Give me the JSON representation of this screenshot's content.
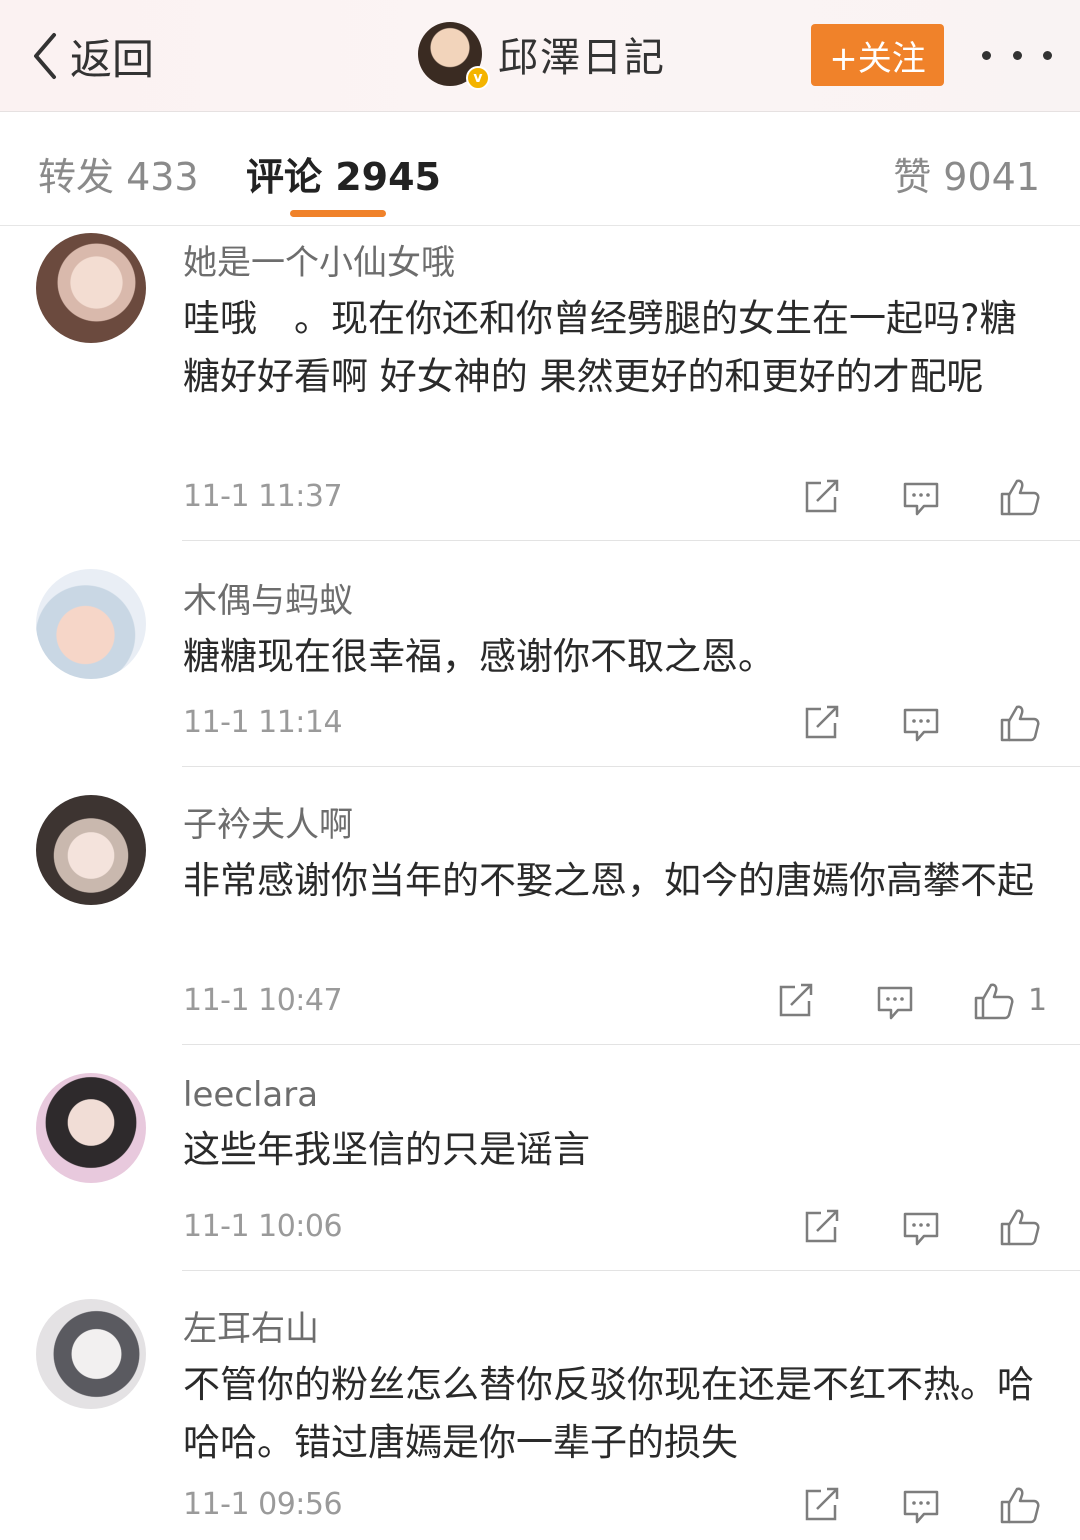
{
  "nav": {
    "back_label": "返回",
    "title": "邱澤日記",
    "follow_label": "+关注",
    "more_icon": "more-dots-icon"
  },
  "tabs": {
    "repost_label": "转发 433",
    "comment_label": "评论 2945",
    "like_label": "赞 9041",
    "active": "comment"
  },
  "colors": {
    "accent": "#f0822a",
    "verify": "#f4b400"
  },
  "comments": [
    {
      "user": "她是一个小仙女哦",
      "text": "哇哦　。现在你还和你曾经劈腿的女生在一起吗?糖糖好好看啊  好女神的   果然更好的和更好的才配呢",
      "time": "11-1 11:37",
      "likes": ""
    },
    {
      "user": "木偶与蚂蚁",
      "text": "糖糖现在很幸福，感谢你不取之恩。",
      "time": "11-1 11:14",
      "likes": ""
    },
    {
      "user": "子衿夫人啊",
      "text": "非常感谢你当年的不娶之恩，如今的唐嫣你高攀不起",
      "time": "11-1 10:47",
      "likes": "1"
    },
    {
      "user": "leeclara",
      "text": "这些年我坚信的只是谣言",
      "time": "11-1 10:06",
      "likes": ""
    },
    {
      "user": "左耳右山",
      "text": "不管你的粉丝怎么替你反驳你现在还是不红不热。哈哈哈。错过唐嫣是你一辈子的损失",
      "time": "11-1 09:56",
      "likes": ""
    }
  ]
}
